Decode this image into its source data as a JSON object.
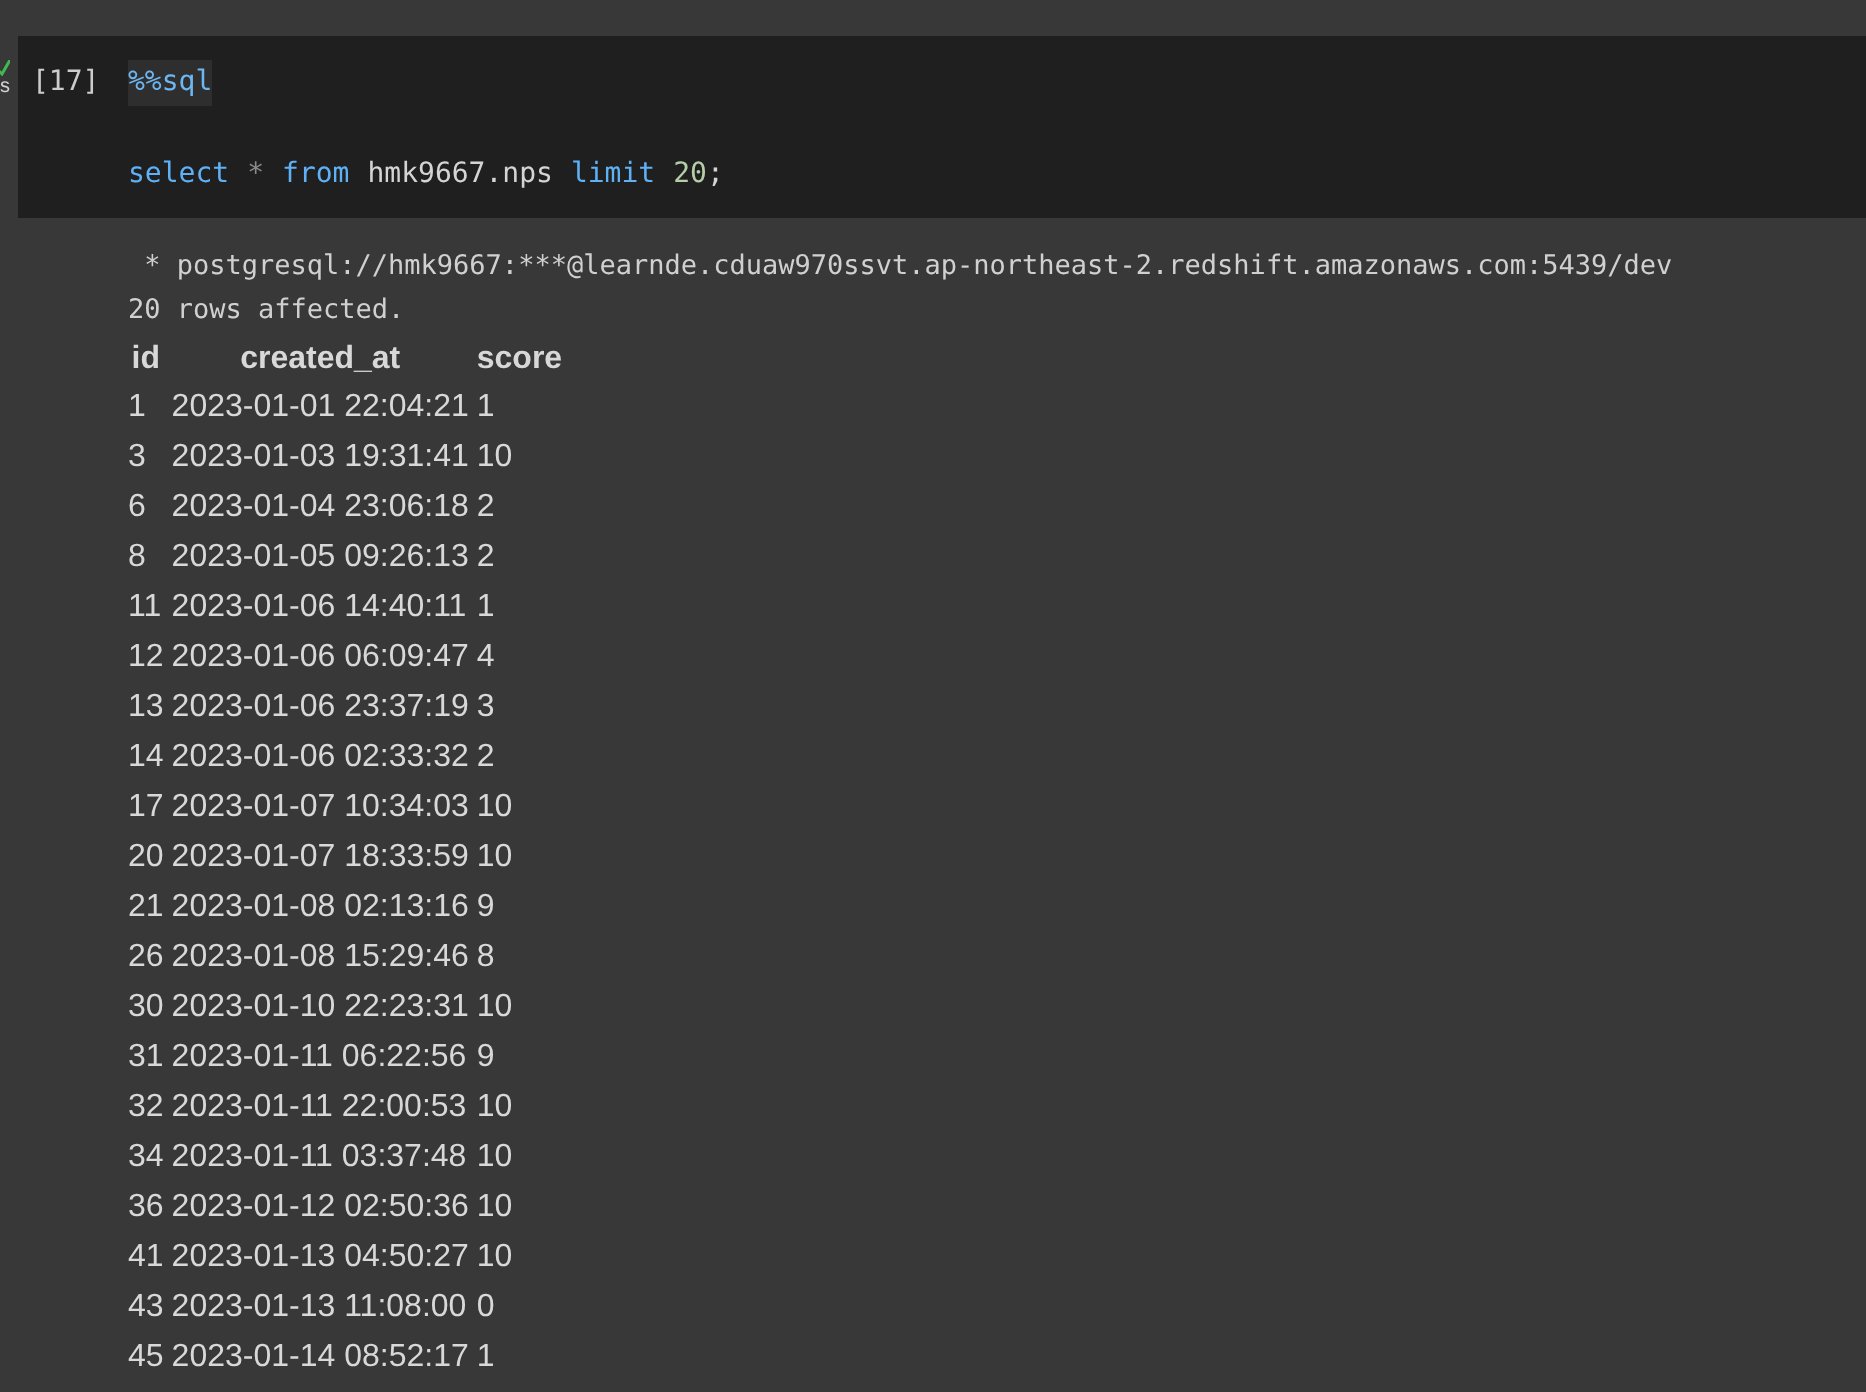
{
  "cell": {
    "succeeded": true,
    "exec_time": "s",
    "execution_count": "[17]",
    "code_lines": [
      {
        "tokens": [
          {
            "kind": "magic",
            "text": "%%sql"
          }
        ]
      },
      {
        "tokens": [
          {
            "kind": "keyword",
            "text": "select"
          },
          {
            "kind": "operator",
            "text": "*"
          },
          {
            "kind": "keyword",
            "text": "from"
          },
          {
            "kind": "name",
            "text": "hmk9667.nps"
          },
          {
            "kind": "keyword",
            "text": "limit"
          },
          {
            "kind": "number",
            "text": "20"
          },
          {
            "kind": "punct",
            "text": ";"
          }
        ]
      }
    ]
  },
  "output": {
    "connection": " * postgresql://hmk9667:***@learnde.cduaw970ssvt.ap-northeast-2.redshift.amazonaws.com:5439/dev",
    "message": "20 rows affected.",
    "table": {
      "columns": [
        "id",
        "created_at",
        "score"
      ],
      "rows": [
        [
          "1",
          "2023-01-01 22:04:21",
          "1"
        ],
        [
          "3",
          "2023-01-03 19:31:41",
          "10"
        ],
        [
          "6",
          "2023-01-04 23:06:18",
          "2"
        ],
        [
          "8",
          "2023-01-05 09:26:13",
          "2"
        ],
        [
          "11",
          "2023-01-06 14:40:11",
          "1"
        ],
        [
          "12",
          "2023-01-06 06:09:47",
          "4"
        ],
        [
          "13",
          "2023-01-06 23:37:19",
          "3"
        ],
        [
          "14",
          "2023-01-06 02:33:32",
          "2"
        ],
        [
          "17",
          "2023-01-07 10:34:03",
          "10"
        ],
        [
          "20",
          "2023-01-07 18:33:59",
          "10"
        ],
        [
          "21",
          "2023-01-08 02:13:16",
          "9"
        ],
        [
          "26",
          "2023-01-08 15:29:46",
          "8"
        ],
        [
          "30",
          "2023-01-10 22:23:31",
          "10"
        ],
        [
          "31",
          "2023-01-11 06:22:56",
          "9"
        ],
        [
          "32",
          "2023-01-11 22:00:53",
          "10"
        ],
        [
          "34",
          "2023-01-11 03:37:48",
          "10"
        ],
        [
          "36",
          "2023-01-12 02:50:36",
          "10"
        ],
        [
          "41",
          "2023-01-13 04:50:27",
          "10"
        ],
        [
          "43",
          "2023-01-13 11:08:00",
          "0"
        ],
        [
          "45",
          "2023-01-14 08:52:17",
          "1"
        ]
      ]
    }
  }
}
